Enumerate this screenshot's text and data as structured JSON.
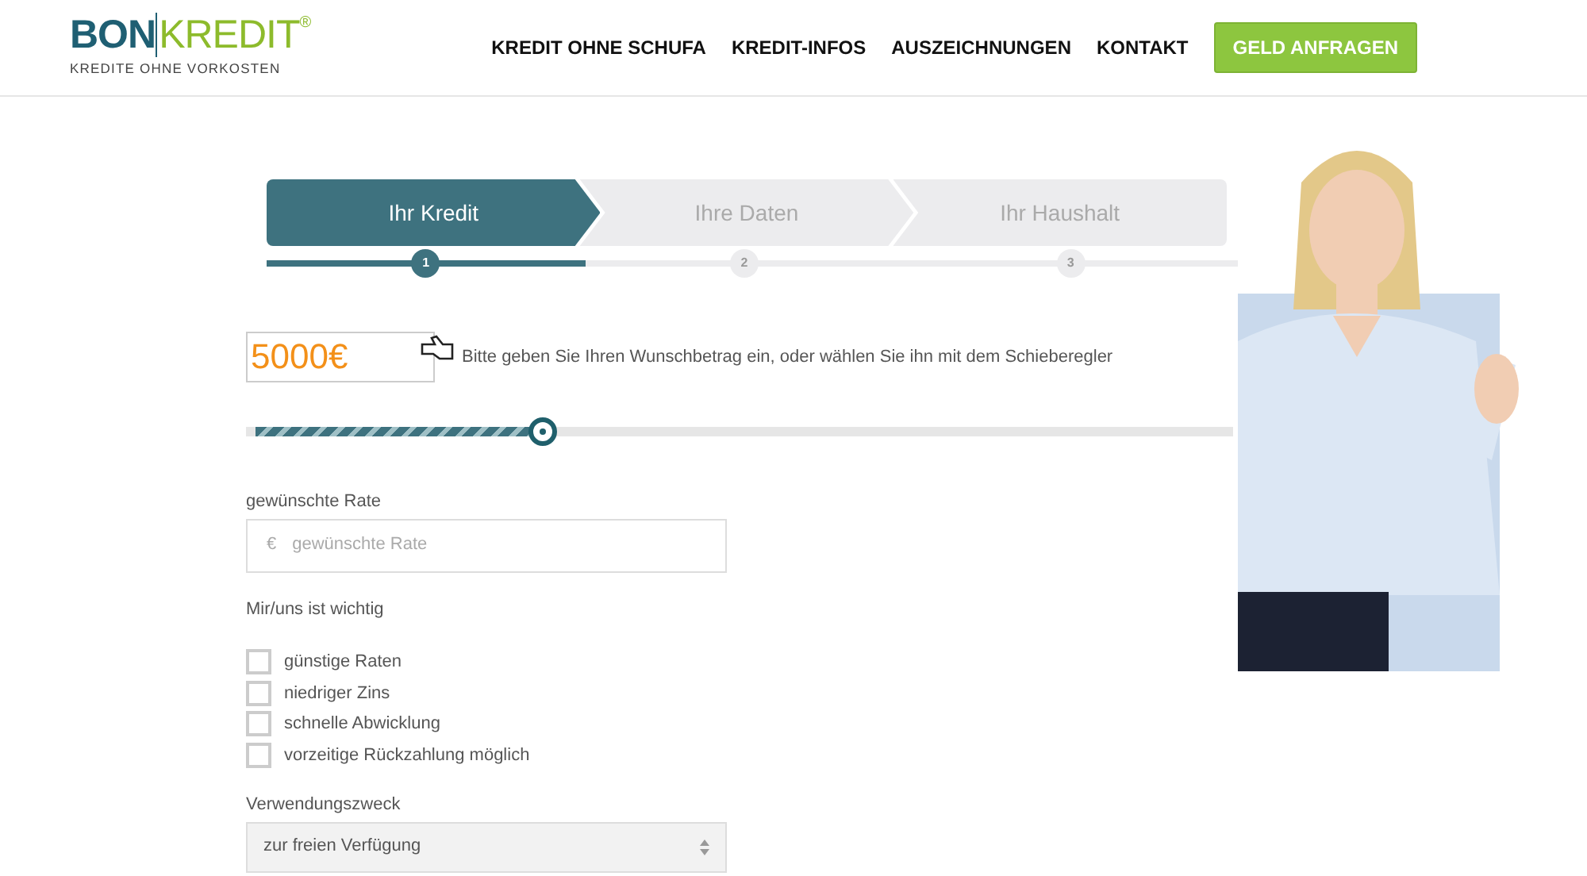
{
  "header": {
    "logo": {
      "brand_left": "BON",
      "brand_right": "KREDIT",
      "registered": "®",
      "tagline": "KREDITE OHNE VORKOSTEN"
    },
    "nav": [
      "KREDIT OHNE SCHUFA",
      "KREDIT-INFOS",
      "AUSZEICHNUNGEN",
      "KONTAKT"
    ],
    "cta": "GELD ANFRAGEN"
  },
  "steps": [
    {
      "label": "Ihr Kredit",
      "number": "1",
      "selected": true
    },
    {
      "label": "Ihre Daten",
      "number": "2",
      "selected": false
    },
    {
      "label": "Ihr Haushalt",
      "number": "3",
      "selected": false
    }
  ],
  "amount": {
    "value": "5000€",
    "hint": "Bitte geben Sie Ihren Wunschbetrag ein, oder wählen Sie ihn mit dem Schieberegler",
    "level": 0.3
  },
  "rate": {
    "label": "gewünschte Rate",
    "prefix": "€",
    "placeholder": "gewünschte Rate"
  },
  "priorities": {
    "label": "Mir/uns ist wichtig",
    "options": [
      {
        "label": "günstige Raten",
        "checked": false
      },
      {
        "label": "niedriger Zins",
        "checked": false
      },
      {
        "label": "schnelle Abwicklung",
        "checked": false
      },
      {
        "label": "vorzeitige Rückzahlung möglich",
        "checked": false
      }
    ]
  },
  "purpose": {
    "label": "Verwendungszweck",
    "value": "zur freien Verfügung"
  }
}
